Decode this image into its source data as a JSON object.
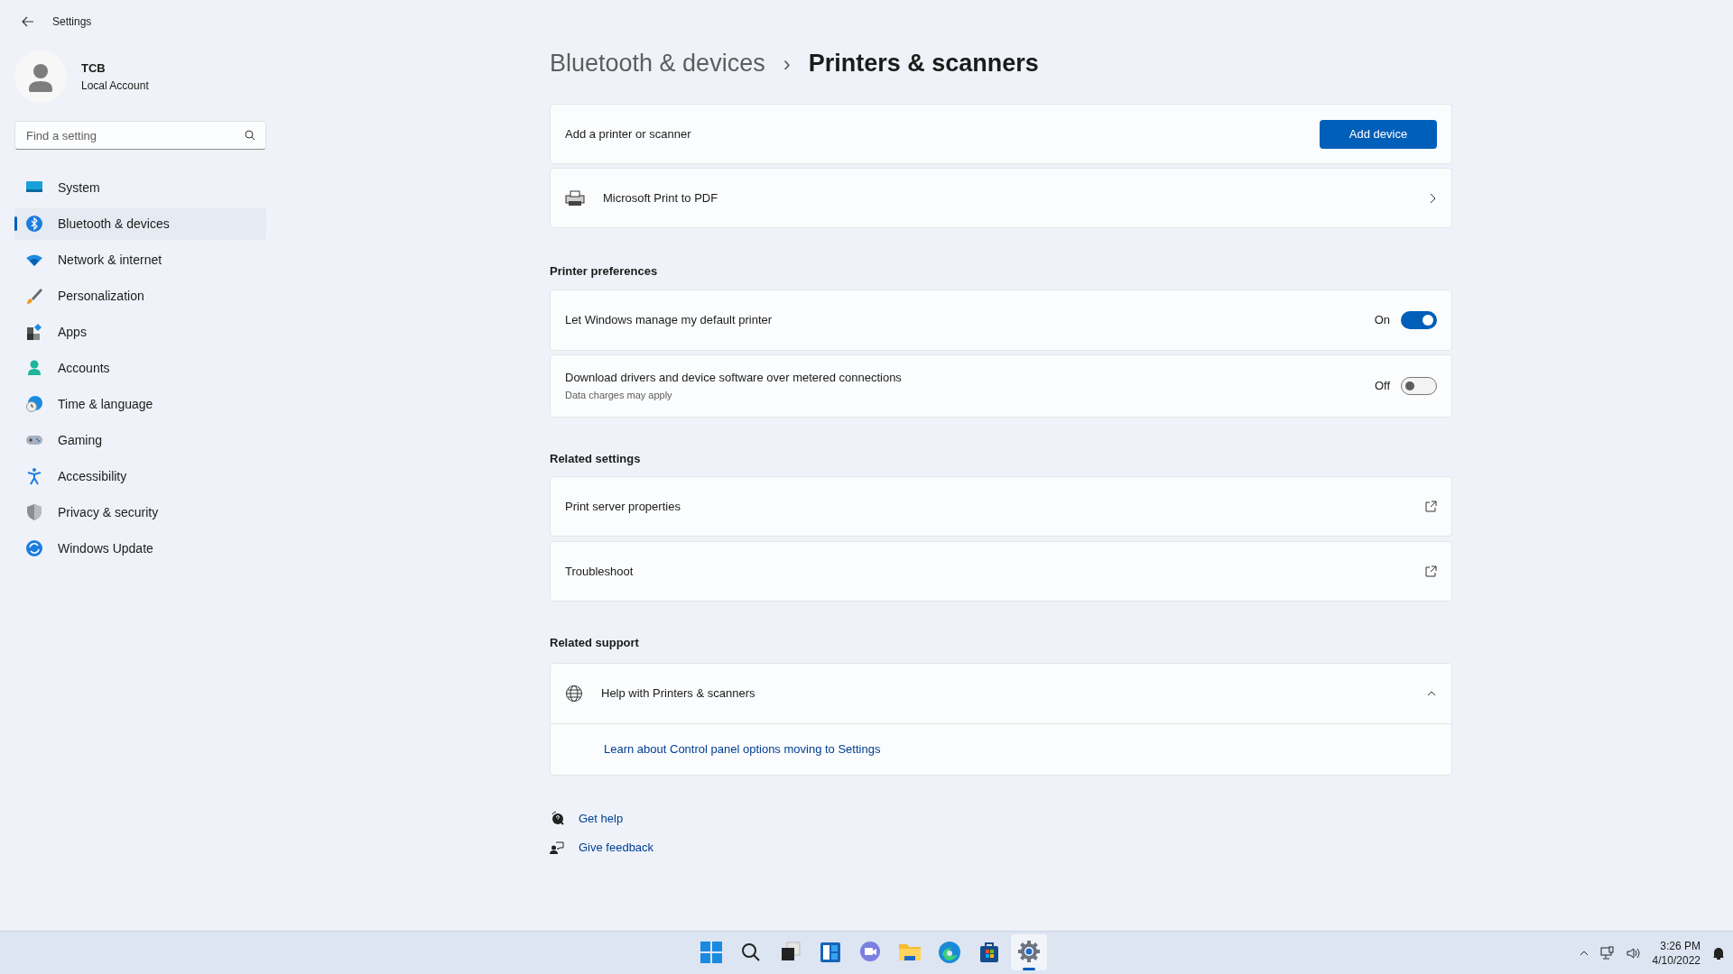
{
  "window": {
    "title": "Settings"
  },
  "account": {
    "name": "TCB",
    "type": "Local Account"
  },
  "search": {
    "placeholder": "Find a setting"
  },
  "sidebar": {
    "items": [
      {
        "label": "System",
        "selected": false
      },
      {
        "label": "Bluetooth & devices",
        "selected": true
      },
      {
        "label": "Network & internet",
        "selected": false
      },
      {
        "label": "Personalization",
        "selected": false
      },
      {
        "label": "Apps",
        "selected": false
      },
      {
        "label": "Accounts",
        "selected": false
      },
      {
        "label": "Time & language",
        "selected": false
      },
      {
        "label": "Gaming",
        "selected": false
      },
      {
        "label": "Accessibility",
        "selected": false
      },
      {
        "label": "Privacy & security",
        "selected": false
      },
      {
        "label": "Windows Update",
        "selected": false
      }
    ]
  },
  "breadcrumb": {
    "parent": "Bluetooth & devices",
    "separator": "›",
    "current": "Printers & scanners"
  },
  "add_card": {
    "label": "Add a printer or scanner",
    "button": "Add device"
  },
  "printers": [
    {
      "name": "Microsoft Print to PDF"
    }
  ],
  "printer_preferences": {
    "heading": "Printer preferences",
    "settings": [
      {
        "label": "Let Windows manage my default printer",
        "state_text": "On",
        "on": true
      },
      {
        "label": "Download drivers and device software over metered connections",
        "description": "Data charges may apply",
        "state_text": "Off",
        "on": false
      }
    ]
  },
  "related_settings": {
    "heading": "Related settings",
    "links": [
      {
        "label": "Print server properties"
      },
      {
        "label": "Troubleshoot"
      }
    ]
  },
  "related_support": {
    "heading": "Related support",
    "expander": {
      "label": "Help with Printers & scanners",
      "expanded": true,
      "links": [
        {
          "label": "Learn about Control panel options moving to Settings"
        }
      ]
    }
  },
  "footer_links": [
    {
      "kind": "help",
      "label": "Get help"
    },
    {
      "kind": "feedback",
      "label": "Give feedback"
    }
  ],
  "taskbar": {
    "apps": [
      {
        "selected": false
      },
      {
        "selected": false
      },
      {
        "selected": false
      },
      {
        "selected": false
      },
      {
        "selected": false
      },
      {
        "selected": false
      },
      {
        "selected": false
      },
      {
        "selected": false
      },
      {
        "selected": true
      }
    ],
    "time": "3:26 PM",
    "date": "4/10/2022"
  }
}
